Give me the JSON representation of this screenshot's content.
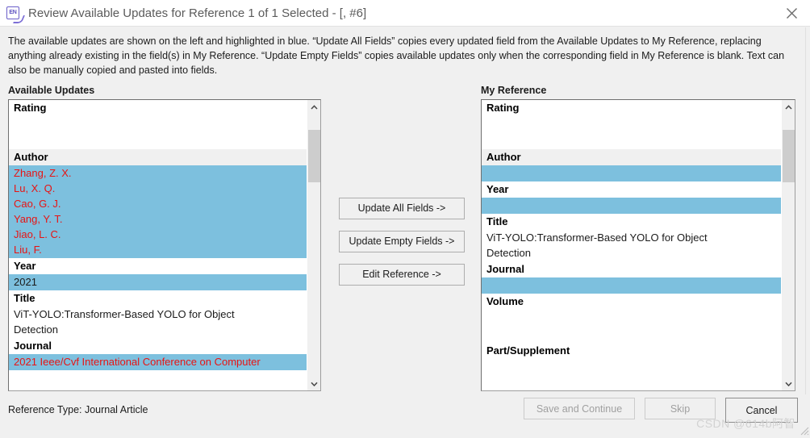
{
  "window": {
    "title": "Review Available Updates for Reference 1 of 1 Selected - [,  #6]",
    "app_icon": "endnote-en-icon",
    "close_icon": "close-icon"
  },
  "description": "The available updates are shown on the left and highlighted in blue. “Update All Fields” copies every updated field from the Available Updates to My Reference, replacing anything already existing in the field(s) in My Reference. “Update Empty Fields” copies available updates only when the corresponding field in My Reference is blank. Text can also be manually copied and pasted into fields.",
  "left_panel": {
    "label": "Available Updates",
    "scroll": {
      "up_icon": "chevron-up-icon",
      "down_icon": "chevron-down-icon",
      "thumb_top_pct": 6,
      "thumb_height_pct": 20
    },
    "fields": [
      {
        "name": "Rating",
        "shaded": false,
        "highlight": false,
        "red": false,
        "lines": [
          ""
        ]
      },
      {
        "name": "Author",
        "shaded": true,
        "highlight": true,
        "red": true,
        "lines": [
          "Zhang, Z. X.",
          "Lu, X. Q.",
          "Cao, G. J.",
          "Yang, Y. T.",
          "Jiao, L. C.",
          "Liu, F."
        ]
      },
      {
        "name": "Year",
        "shaded": false,
        "highlight": true,
        "red": false,
        "lines": [
          "2021"
        ]
      },
      {
        "name": "Title",
        "shaded": false,
        "highlight": false,
        "red": false,
        "lines": [
          "ViT-YOLO:Transformer-Based YOLO for Object",
          "Detection"
        ]
      },
      {
        "name": "Journal",
        "shaded": false,
        "highlight": true,
        "red": true,
        "lines": [
          "2021 Ieee/Cvf International Conference on Computer"
        ]
      }
    ]
  },
  "right_panel": {
    "label": "My Reference",
    "scroll": {
      "up_icon": "chevron-up-icon",
      "down_icon": "chevron-down-icon",
      "thumb_top_pct": 6,
      "thumb_height_pct": 20
    },
    "fields": [
      {
        "name": "Rating",
        "shaded": false,
        "highlight": false,
        "red": false,
        "lines": [
          ""
        ]
      },
      {
        "name": "Author",
        "shaded": true,
        "highlight": true,
        "red": false,
        "lines": [
          ""
        ]
      },
      {
        "name": "Year",
        "shaded": false,
        "highlight": true,
        "red": false,
        "lines": [
          ""
        ]
      },
      {
        "name": "Title",
        "shaded": false,
        "highlight": false,
        "red": false,
        "lines": [
          "ViT-YOLO:Transformer-Based YOLO for Object",
          "Detection"
        ]
      },
      {
        "name": "Journal",
        "shaded": false,
        "highlight": true,
        "red": false,
        "lines": [
          ""
        ]
      },
      {
        "name": "Volume",
        "shaded": false,
        "highlight": false,
        "red": false,
        "lines": [
          ""
        ]
      },
      {
        "name": "Part/Supplement",
        "shaded": false,
        "highlight": false,
        "red": false,
        "lines": [
          ""
        ]
      }
    ]
  },
  "middle_buttons": {
    "update_all": "Update All Fields ->",
    "update_empty": "Update Empty Fields ->",
    "edit_reference": "Edit Reference ->"
  },
  "footer": {
    "reference_type": "Reference Type: Journal Article",
    "save_and_continue": "Save and Continue",
    "skip": "Skip",
    "cancel": "Cancel",
    "save_enabled": false,
    "skip_enabled": false
  },
  "watermark": "CSDN @614b阿智",
  "colors": {
    "highlight_blue": "#7dc0de",
    "red_text": "#e81313",
    "field_shaded": "#f0f0f0",
    "window_bg": "#f0f0f0",
    "title_text": "#5b5b5b",
    "accent_icon": "#5b4fc0"
  }
}
